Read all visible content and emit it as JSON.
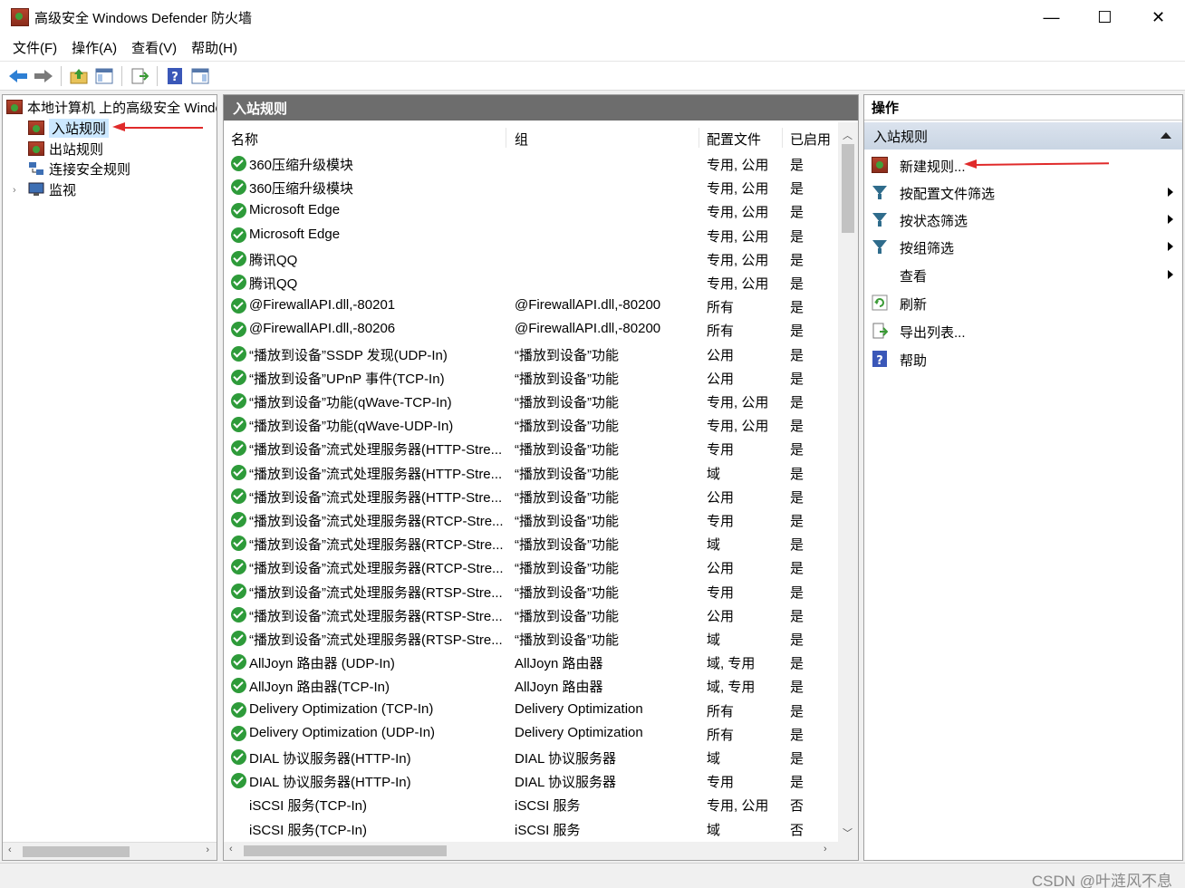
{
  "window": {
    "title": "高级安全 Windows Defender 防火墙",
    "minimize": "—",
    "maximize": "☐",
    "close": "✕"
  },
  "menu": [
    "文件(F)",
    "操作(A)",
    "查看(V)",
    "帮助(H)"
  ],
  "tree": {
    "root": "本地计算机 上的高级安全 Windows Defender 防火墙",
    "items": [
      "入站规则",
      "出站规则",
      "连接安全规则",
      "监视"
    ],
    "selected": "入站规则"
  },
  "middle": {
    "header": "入站规则",
    "columns": [
      "名称",
      "组",
      "配置文件",
      "已启用"
    ],
    "rows": [
      {
        "name": "360压缩升级模块",
        "group": "",
        "profile": "专用, 公用",
        "enabled": "是",
        "active": true
      },
      {
        "name": "360压缩升级模块",
        "group": "",
        "profile": "专用, 公用",
        "enabled": "是",
        "active": true
      },
      {
        "name": "Microsoft Edge",
        "group": "",
        "profile": "专用, 公用",
        "enabled": "是",
        "active": true
      },
      {
        "name": "Microsoft Edge",
        "group": "",
        "profile": "专用, 公用",
        "enabled": "是",
        "active": true
      },
      {
        "name": "腾讯QQ",
        "group": "",
        "profile": "专用, 公用",
        "enabled": "是",
        "active": true
      },
      {
        "name": "腾讯QQ",
        "group": "",
        "profile": "专用, 公用",
        "enabled": "是",
        "active": true
      },
      {
        "name": "@FirewallAPI.dll,-80201",
        "group": "@FirewallAPI.dll,-80200",
        "profile": "所有",
        "enabled": "是",
        "active": true
      },
      {
        "name": "@FirewallAPI.dll,-80206",
        "group": "@FirewallAPI.dll,-80200",
        "profile": "所有",
        "enabled": "是",
        "active": true
      },
      {
        "name": "“播放到设备”SSDP 发现(UDP-In)",
        "group": "“播放到设备”功能",
        "profile": "公用",
        "enabled": "是",
        "active": true
      },
      {
        "name": "“播放到设备”UPnP 事件(TCP-In)",
        "group": "“播放到设备”功能",
        "profile": "公用",
        "enabled": "是",
        "active": true
      },
      {
        "name": "“播放到设备”功能(qWave-TCP-In)",
        "group": "“播放到设备”功能",
        "profile": "专用, 公用",
        "enabled": "是",
        "active": true
      },
      {
        "name": "“播放到设备”功能(qWave-UDP-In)",
        "group": "“播放到设备”功能",
        "profile": "专用, 公用",
        "enabled": "是",
        "active": true
      },
      {
        "name": "“播放到设备”流式处理服务器(HTTP-Stre...",
        "group": "“播放到设备”功能",
        "profile": "专用",
        "enabled": "是",
        "active": true
      },
      {
        "name": "“播放到设备”流式处理服务器(HTTP-Stre...",
        "group": "“播放到设备”功能",
        "profile": "域",
        "enabled": "是",
        "active": true
      },
      {
        "name": "“播放到设备”流式处理服务器(HTTP-Stre...",
        "group": "“播放到设备”功能",
        "profile": "公用",
        "enabled": "是",
        "active": true
      },
      {
        "name": "“播放到设备”流式处理服务器(RTCP-Stre...",
        "group": "“播放到设备”功能",
        "profile": "专用",
        "enabled": "是",
        "active": true
      },
      {
        "name": "“播放到设备”流式处理服务器(RTCP-Stre...",
        "group": "“播放到设备”功能",
        "profile": "域",
        "enabled": "是",
        "active": true
      },
      {
        "name": "“播放到设备”流式处理服务器(RTCP-Stre...",
        "group": "“播放到设备”功能",
        "profile": "公用",
        "enabled": "是",
        "active": true
      },
      {
        "name": "“播放到设备”流式处理服务器(RTSP-Stre...",
        "group": "“播放到设备”功能",
        "profile": "专用",
        "enabled": "是",
        "active": true
      },
      {
        "name": "“播放到设备”流式处理服务器(RTSP-Stre...",
        "group": "“播放到设备”功能",
        "profile": "公用",
        "enabled": "是",
        "active": true
      },
      {
        "name": "“播放到设备”流式处理服务器(RTSP-Stre...",
        "group": "“播放到设备”功能",
        "profile": "域",
        "enabled": "是",
        "active": true
      },
      {
        "name": "AllJoyn 路由器 (UDP-In)",
        "group": "AllJoyn 路由器",
        "profile": "域, 专用",
        "enabled": "是",
        "active": true
      },
      {
        "name": "AllJoyn 路由器(TCP-In)",
        "group": "AllJoyn 路由器",
        "profile": "域, 专用",
        "enabled": "是",
        "active": true
      },
      {
        "name": "Delivery Optimization (TCP-In)",
        "group": "Delivery Optimization",
        "profile": "所有",
        "enabled": "是",
        "active": true
      },
      {
        "name": "Delivery Optimization (UDP-In)",
        "group": "Delivery Optimization",
        "profile": "所有",
        "enabled": "是",
        "active": true
      },
      {
        "name": "DIAL 协议服务器(HTTP-In)",
        "group": "DIAL 协议服务器",
        "profile": "域",
        "enabled": "是",
        "active": true
      },
      {
        "name": "DIAL 协议服务器(HTTP-In)",
        "group": "DIAL 协议服务器",
        "profile": "专用",
        "enabled": "是",
        "active": true
      },
      {
        "name": "iSCSI 服务(TCP-In)",
        "group": "iSCSI 服务",
        "profile": "专用, 公用",
        "enabled": "否",
        "active": false
      },
      {
        "name": "iSCSI 服务(TCP-In)",
        "group": "iSCSI 服务",
        "profile": "域",
        "enabled": "否",
        "active": false
      }
    ]
  },
  "actions": {
    "header": "操作",
    "section": "入站规则",
    "items": [
      {
        "label": "新建规则...",
        "icon": "new-rule-icon",
        "submenu": false
      },
      {
        "label": "按配置文件筛选",
        "icon": "filter-icon",
        "submenu": true
      },
      {
        "label": "按状态筛选",
        "icon": "filter-icon",
        "submenu": true
      },
      {
        "label": "按组筛选",
        "icon": "filter-icon",
        "submenu": true
      },
      {
        "label": "查看",
        "icon": "",
        "submenu": true
      },
      {
        "label": "刷新",
        "icon": "refresh-icon",
        "submenu": false
      },
      {
        "label": "导出列表...",
        "icon": "export-icon",
        "submenu": false
      },
      {
        "label": "帮助",
        "icon": "help-icon",
        "submenu": false
      }
    ]
  },
  "watermark": "CSDN @叶涟风不息",
  "colors": {
    "accent_red": "#e02a2a",
    "enabled_green": "#2e9b3a",
    "pane_header": "#6d6d6d",
    "selection": "#cce8ff"
  }
}
